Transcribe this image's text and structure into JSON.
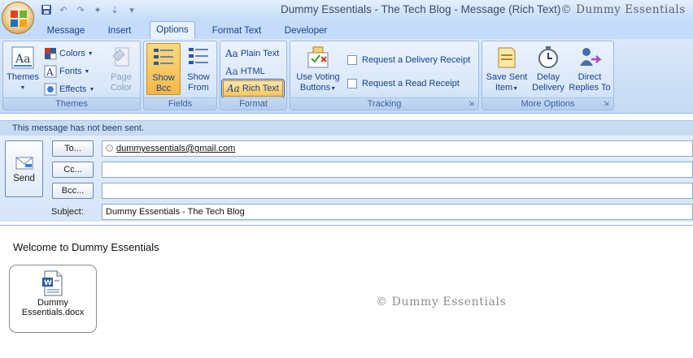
{
  "window": {
    "title": "Dummy Essentials - The Tech Blog - Message (Rich Text)",
    "watermark": "© Dummy Essentials"
  },
  "quick_access": [
    {
      "icon": "save-icon"
    },
    {
      "icon": "undo-icon"
    },
    {
      "icon": "redo-icon"
    },
    {
      "icon": "up-arrow-icon"
    },
    {
      "icon": "down-arrow-icon"
    },
    {
      "icon": "customize-qat-icon"
    }
  ],
  "tabs": [
    {
      "label": "Message",
      "active": false
    },
    {
      "label": "Insert",
      "active": false
    },
    {
      "label": "Options",
      "active": true
    },
    {
      "label": "Format Text",
      "active": false
    },
    {
      "label": "Developer",
      "active": false
    }
  ],
  "ribbon": {
    "themes": {
      "label": "Themes",
      "themes_button": "Themes",
      "colors": "Colors",
      "fonts": "Fonts",
      "effects": "Effects",
      "page_color_1": "Page",
      "page_color_2": "Color"
    },
    "fields": {
      "label": "Fields",
      "show_bcc_1": "Show",
      "show_bcc_2": "Bcc",
      "show_from_1": "Show",
      "show_from_2": "From"
    },
    "format": {
      "label": "Format",
      "plain_text": "Plain Text",
      "html": "HTML",
      "rich_text": "Rich Text",
      "selected": "Rich Text"
    },
    "tracking": {
      "label": "Tracking",
      "voting_1": "Use Voting",
      "voting_2": "Buttons",
      "delivery_receipt": "Request a Delivery Receipt",
      "read_receipt": "Request a Read Receipt"
    },
    "more_options": {
      "label": "More Options",
      "save_sent_1": "Save Sent",
      "save_sent_2": "Item",
      "delay_1": "Delay",
      "delay_2": "Delivery",
      "direct_1": "Direct",
      "direct_2": "Replies To"
    }
  },
  "info_bar": "This message has not been sent.",
  "header": {
    "send": "Send",
    "to_label": "To...",
    "to_value": "dummyessentials@gmail.com",
    "cc_label": "Cc...",
    "cc_value": "",
    "bcc_label": "Bcc...",
    "bcc_value": "",
    "subject_label": "Subject:",
    "subject_value": "Dummy Essentials - The Tech Blog"
  },
  "body": {
    "text": "Welcome to Dummy Essentials",
    "attachment_1": "Dummy",
    "attachment_2": "Essentials.docx",
    "watermark": "© Dummy Essentials"
  },
  "colors": {
    "ribbon_bg": "#c5daf5",
    "accent_text": "#15428b",
    "pressed_button": "#f7b747"
  }
}
